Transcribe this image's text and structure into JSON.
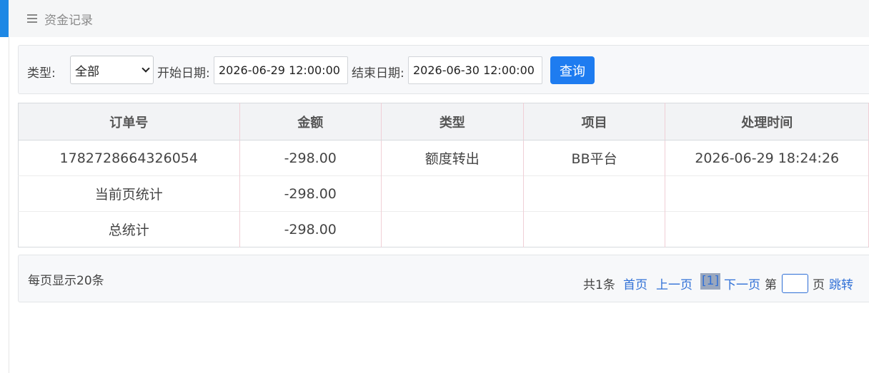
{
  "header": {
    "title": "资金记录",
    "menu_icon": "menu-icon"
  },
  "filters": {
    "type_label": "类型:",
    "type_value": "全部",
    "start_label": "开始日期:",
    "start_value": "2026-06-29 12:00:00",
    "end_label": "结束日期:",
    "end_value": "2026-06-30 12:00:00",
    "query_button": "查询"
  },
  "table": {
    "columns": [
      "订单号",
      "金额",
      "类型",
      "项目",
      "处理时间"
    ],
    "rows": [
      [
        "1782728664326054",
        "-298.00",
        "额度转出",
        "BB平台",
        "2026-06-29 18:24:26"
      ]
    ],
    "page_total": {
      "label": "当前页统计",
      "amount": "-298.00"
    },
    "grand_total": {
      "label": "总统计",
      "amount": "-298.00"
    }
  },
  "pagination": {
    "per_page": "每页显示20条",
    "total": "共1条",
    "first": "首页",
    "prev": "上一页",
    "current": "[1]",
    "next": "下一页",
    "page_prefix": "第",
    "page_suffix": "页",
    "jump": "跳转"
  },
  "colors": {
    "accent": "#1e88e5",
    "button": "#1e7cf0",
    "link": "#2f6fd6"
  }
}
